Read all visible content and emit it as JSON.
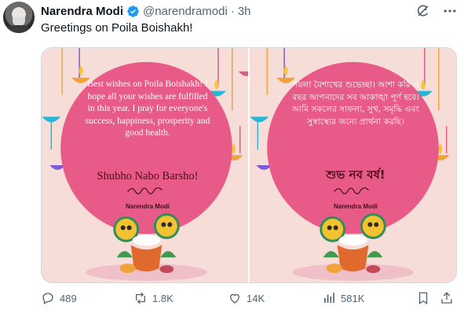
{
  "author": {
    "display_name": "Narendra Modi",
    "handle": "@narendramodi",
    "separator": "·",
    "time": "3h"
  },
  "tweet": {
    "text": "Greetings on Poila Boishakh!"
  },
  "media": {
    "card_english": {
      "message": "Best wishes on Poila Boishakh! I hope all your wishes are fulfilled in this year. I pray for everyone's success, happiness, prosperity and good health.",
      "greeting": "Shubho Nabo Barsho!",
      "signature_name": "Narendra Modi"
    },
    "card_bengali": {
      "message": "পয়লা বৈশাখের শুভেচ্ছা। আশা করি এ বছর আপনাদের সব আকাঙ্খা পূর্ণ হবে। আমি সকলের সাফল্য, সুখ, সমৃদ্ধি এবং সুস্বাস্থ্যের জন্যে প্রার্থনা করছি।",
      "greeting": "শুভ নব বর্ষ!",
      "signature_name": "Narendra Modi"
    }
  },
  "actions": {
    "replies": "489",
    "reposts": "1.8K",
    "likes": "14K",
    "views": "581K"
  },
  "colors": {
    "accent_blue": "#1d9bf0",
    "muted_text": "#536471",
    "card_background": "#f7ddd7",
    "circle_pink": "#e85a87"
  },
  "icons": [
    "verified-badge-icon",
    "grok-icon",
    "more-icon",
    "reply-icon",
    "repost-icon",
    "like-icon",
    "views-icon",
    "bookmark-icon",
    "share-icon"
  ]
}
